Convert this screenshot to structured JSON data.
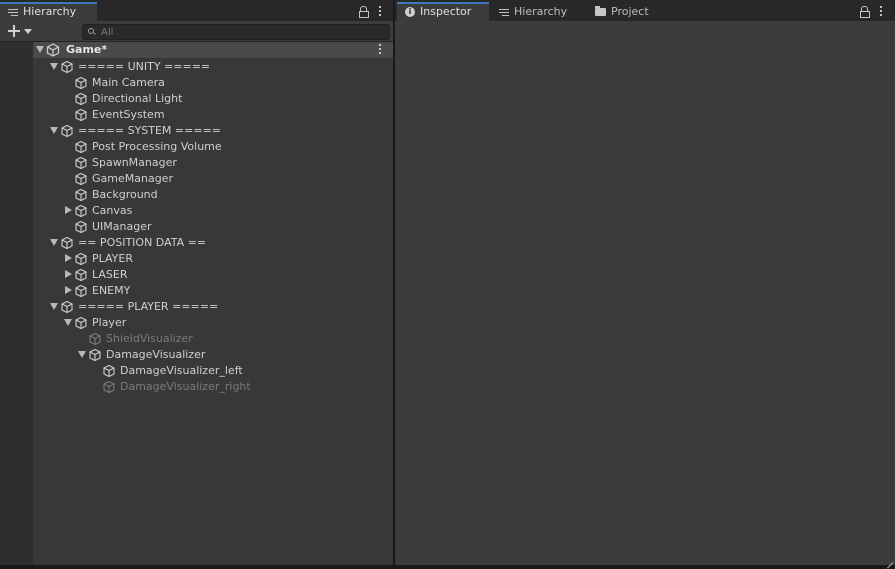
{
  "hierarchy_panel": {
    "tab_label": "Hierarchy",
    "search": {
      "placeholder": "All",
      "value": ""
    },
    "scene": {
      "label": "Game*"
    },
    "items": [
      {
        "label": "===== UNITY =====",
        "foldout": "open",
        "disabled": false
      },
      {
        "label": "Main Camera",
        "foldout": "none",
        "disabled": false
      },
      {
        "label": "Directional Light",
        "foldout": "none",
        "disabled": false
      },
      {
        "label": "EventSystem",
        "foldout": "none",
        "disabled": false
      },
      {
        "label": "===== SYSTEM =====",
        "foldout": "open",
        "disabled": false
      },
      {
        "label": "Post Processing Volume",
        "foldout": "none",
        "disabled": false
      },
      {
        "label": "SpawnManager",
        "foldout": "none",
        "disabled": false
      },
      {
        "label": "GameManager",
        "foldout": "none",
        "disabled": false
      },
      {
        "label": "Background",
        "foldout": "none",
        "disabled": false
      },
      {
        "label": "Canvas",
        "foldout": "closed",
        "disabled": false
      },
      {
        "label": "UIManager",
        "foldout": "none",
        "disabled": false
      },
      {
        "label": "== POSITION DATA ==",
        "foldout": "open",
        "disabled": false
      },
      {
        "label": "PLAYER",
        "foldout": "closed",
        "disabled": false
      },
      {
        "label": "LASER",
        "foldout": "closed",
        "disabled": false
      },
      {
        "label": "ENEMY",
        "foldout": "closed",
        "disabled": false
      },
      {
        "label": "===== PLAYER =====",
        "foldout": "open",
        "disabled": false
      },
      {
        "label": "Player",
        "foldout": "open",
        "disabled": false
      },
      {
        "label": "ShieldVisualizer",
        "foldout": "none",
        "disabled": true
      },
      {
        "label": "DamageVisualizer",
        "foldout": "open",
        "disabled": false
      },
      {
        "label": "DamageVisualizer_left",
        "foldout": "none",
        "disabled": false
      },
      {
        "label": "DamageVisualizer_right",
        "foldout": "none",
        "disabled": true
      }
    ]
  },
  "right_panel": {
    "tabs": [
      {
        "label": "Inspector",
        "icon": "info-icon",
        "active": true
      },
      {
        "label": "Hierarchy",
        "icon": "list-icon",
        "active": false
      },
      {
        "label": "Project",
        "icon": "folder-icon",
        "active": false
      }
    ]
  },
  "colors": {
    "tab_accent": "#3a79bb",
    "panel_bg": "#383838",
    "text": "#d0d0d0",
    "disabled_text": "#7a7a7a"
  }
}
